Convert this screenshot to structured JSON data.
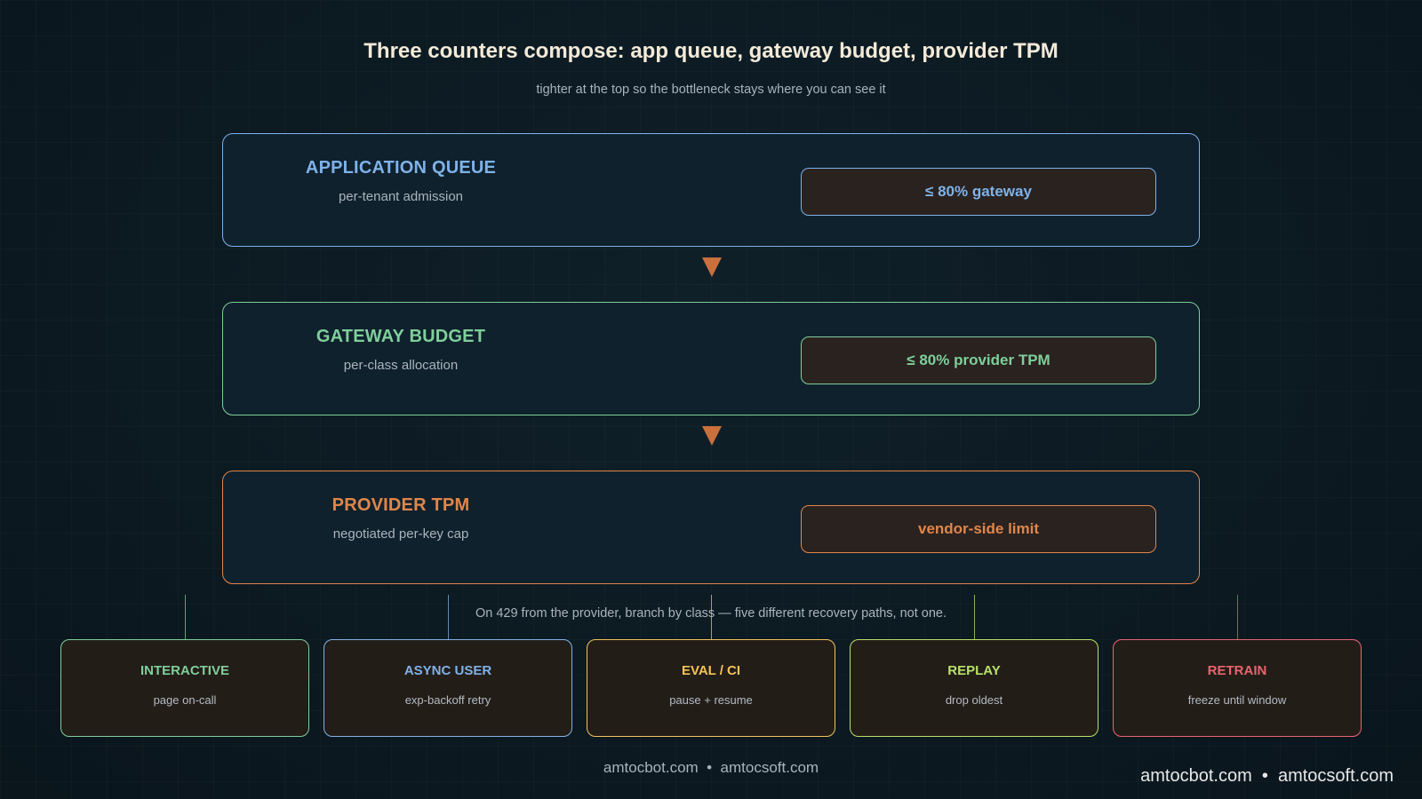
{
  "header": {
    "title": "Three counters compose: app queue, gateway budget, provider TPM",
    "subtitle": "tighter at the top so the bottleneck stays where you can see it"
  },
  "layers": [
    {
      "name": "APPLICATION QUEUE",
      "desc": "per-tenant admission",
      "badge": "≤ 80% gateway",
      "color": "#7fb2e8"
    },
    {
      "name": "GATEWAY BUDGET",
      "desc": "per-class allocation",
      "badge": "≤ 80% provider TPM",
      "color": "#7fcf9a"
    },
    {
      "name": "PROVIDER TPM",
      "desc": "negotiated per-key cap",
      "badge": "vendor-side limit",
      "color": "#e0864a"
    }
  ],
  "branch_note": "On 429 from the provider, branch by class — five different recovery paths, not one.",
  "classes": [
    {
      "name": "INTERACTIVE",
      "desc": "page on-call",
      "color": "#7fcf9a"
    },
    {
      "name": "ASYNC USER",
      "desc": "exp-backoff retry",
      "color": "#7fb2e8"
    },
    {
      "name": "EVAL / CI",
      "desc": "pause + resume",
      "color": "#f2c35a"
    },
    {
      "name": "REPLAY",
      "desc": "drop oldest",
      "color": "#b8e06a"
    },
    {
      "name": "RETRAIN",
      "desc": "freeze until window",
      "color": "#e8656e"
    }
  ],
  "footer": {
    "center": "amtocbot.com  •  amtocsoft.com",
    "right": "amtocbot.com  •  amtocsoft.com"
  }
}
